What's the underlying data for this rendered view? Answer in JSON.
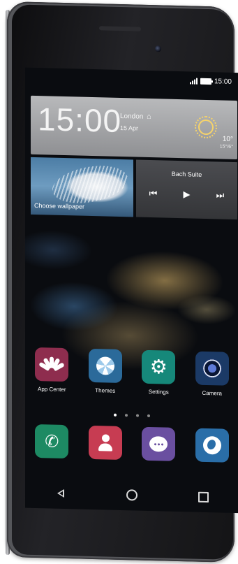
{
  "status_bar": {
    "time": "15:00",
    "signal_icon": "signal-icon",
    "battery_icon": "battery-icon"
  },
  "clock_widget": {
    "time": "15:00",
    "city": "London",
    "city_icon": "home-icon",
    "date": "15 Apr",
    "weather_icon": "sun-icon",
    "temperature": "10°",
    "temperature_range": "15°/6°"
  },
  "gallery_widget": {
    "label": "Choose wallpaper"
  },
  "music_widget": {
    "title": "Bach Suite",
    "controls": [
      "previous-icon",
      "play-icon",
      "next-icon"
    ]
  },
  "apps_row_1": [
    {
      "label": "App Center",
      "icon": "huawei-petal-icon"
    },
    {
      "label": "Themes",
      "icon": "themes-swirl-icon"
    },
    {
      "label": "Settings",
      "icon": "gear-icon"
    },
    {
      "label": "Camera",
      "icon": "camera-lens-icon"
    }
  ],
  "page_indicator": {
    "count": 4,
    "active_index": 0
  },
  "apps_row_2": [
    {
      "label": "",
      "icon": "phone-icon"
    },
    {
      "label": "",
      "icon": "contacts-icon"
    },
    {
      "label": "",
      "icon": "messages-icon"
    },
    {
      "label": "",
      "icon": "browser-globe-icon"
    }
  ],
  "nav_bar": [
    "back-icon",
    "home-circle-icon",
    "recent-apps-icon"
  ],
  "colors": {
    "app_center": "#8e2d4e",
    "themes": "#2b6a9a",
    "settings": "#16887a",
    "camera": "#1b3a66",
    "phone": "#1d8a63",
    "contacts": "#c73c52",
    "messages": "#6a4fa0",
    "browser": "#2a6ea8"
  }
}
